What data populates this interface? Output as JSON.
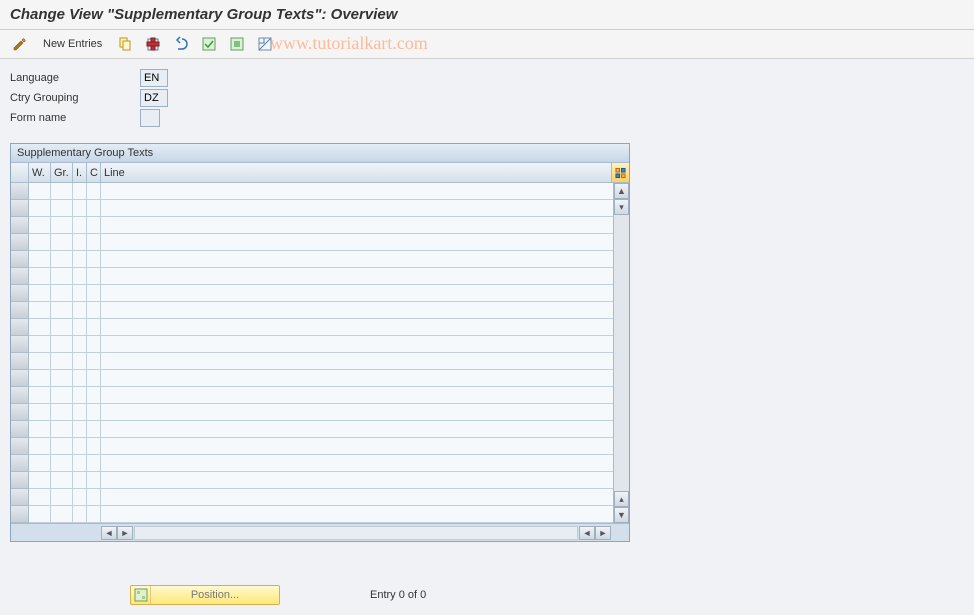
{
  "title": "Change View \"Supplementary Group Texts\": Overview",
  "toolbar": {
    "new_entries_label": "New Entries"
  },
  "watermark": "www.tutorialkart.com",
  "form": {
    "language": {
      "label": "Language",
      "value": "EN"
    },
    "ctry_grouping": {
      "label": "Ctry Grouping",
      "value": "DZ"
    },
    "form_name": {
      "label": "Form name",
      "value": ""
    }
  },
  "grid": {
    "title": "Supplementary Group Texts",
    "columns": {
      "w": "W.",
      "gr": "Gr.",
      "i": "I.",
      "c": "C",
      "line": "Line"
    },
    "row_count": 20
  },
  "footer": {
    "position_label": "Position...",
    "entry_text": "Entry 0 of 0"
  }
}
